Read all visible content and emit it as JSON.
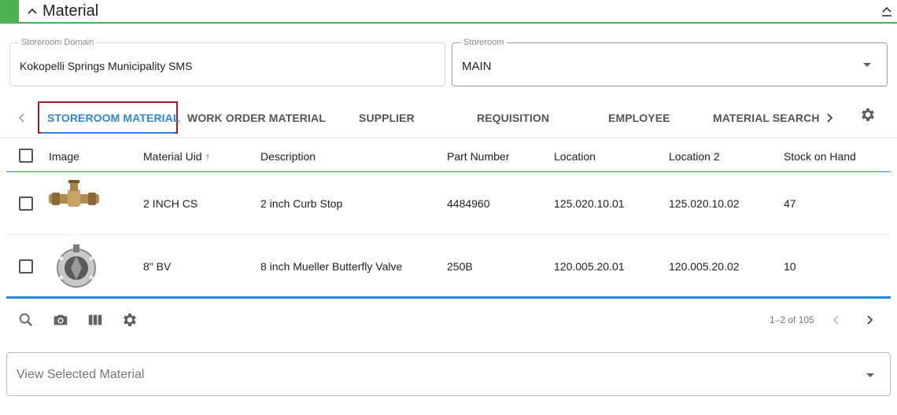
{
  "header": {
    "title": "Material"
  },
  "storeroom_domain": {
    "label": "Storeroom Domain",
    "value": "Kokopelli Springs Municipality SMS"
  },
  "storeroom": {
    "label": "Storeroom",
    "value": "MAIN"
  },
  "tabs": [
    {
      "label": "STOREROOM MATERIAL",
      "active": true
    },
    {
      "label": "WORK ORDER MATERIAL",
      "active": false
    },
    {
      "label": "SUPPLIER",
      "active": false
    },
    {
      "label": "REQUISITION",
      "active": false
    },
    {
      "label": "EMPLOYEE",
      "active": false
    },
    {
      "label": "MATERIAL SEARCH",
      "active": false
    }
  ],
  "table": {
    "columns": [
      "Image",
      "Material Uid",
      "Description",
      "Part Number",
      "Location",
      "Location 2",
      "Stock on Hand"
    ],
    "sort_indicator": "↑",
    "rows": [
      {
        "material_uid": "2 INCH CS",
        "description": "2 inch Curb Stop",
        "part_number": "4484960",
        "location": "125.020.10.01",
        "location2": "125.020.10.02",
        "stock": "47",
        "image_icon": "curb-stop-image"
      },
      {
        "material_uid": "8\" BV",
        "description": "8 inch Mueller Butterfly Valve",
        "part_number": "250B",
        "location": "120.005.20.01",
        "location2": "120.005.20.02",
        "stock": "10",
        "image_icon": "butterfly-valve-image"
      }
    ]
  },
  "footer": {
    "page_info": "1–2 of 105"
  },
  "view_selected": {
    "placeholder": "View Selected Material"
  },
  "colors": {
    "accent_green": "#4caf50",
    "accent_blue": "#2e86de",
    "active_box": "#a02020"
  },
  "icons": [
    "chevron-up-icon",
    "collapse-icon",
    "chevron-left-icon",
    "chevron-right-icon",
    "gear-icon",
    "search-icon",
    "camera-icon",
    "columns-icon",
    "dropdown-arrow-icon"
  ]
}
